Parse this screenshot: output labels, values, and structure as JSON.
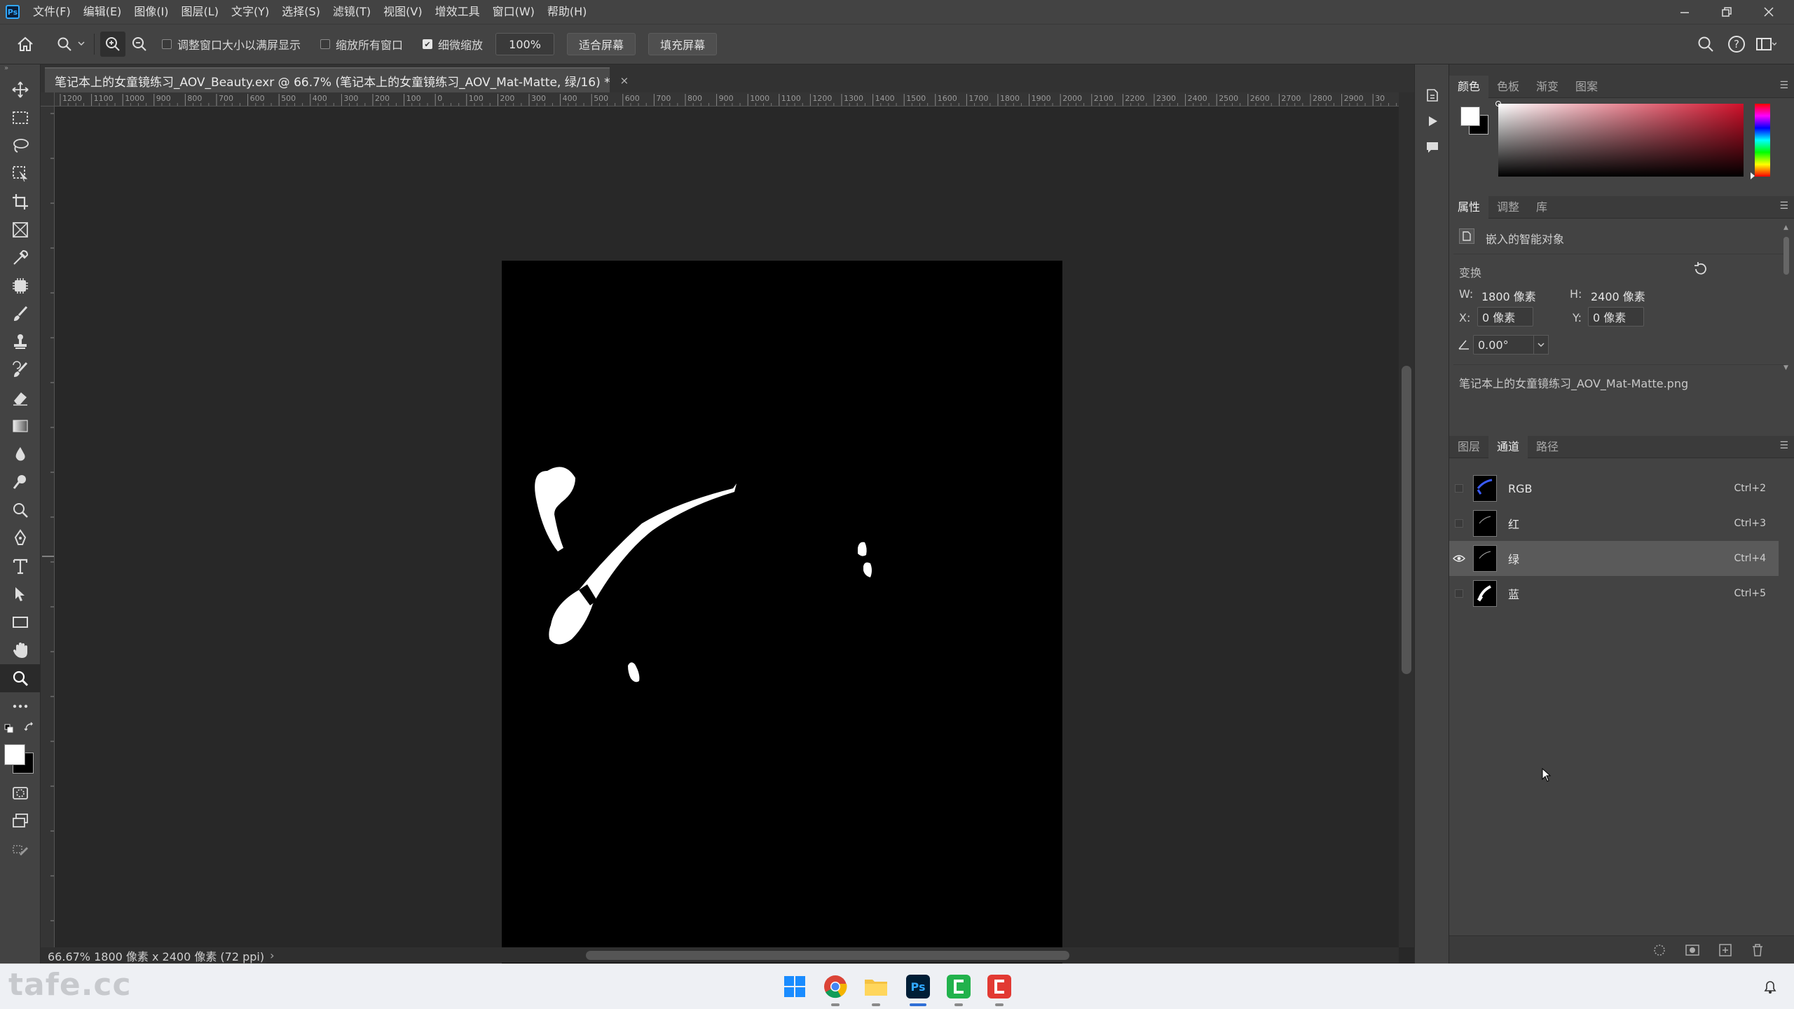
{
  "menubar": {
    "app_logo": "Ps",
    "items": [
      "文件(F)",
      "编辑(E)",
      "图像(I)",
      "图层(L)",
      "文字(Y)",
      "选择(S)",
      "滤镜(T)",
      "视图(V)",
      "增效工具",
      "窗口(W)",
      "帮助(H)"
    ]
  },
  "optionsbar": {
    "resize_windows_label": "调整窗口大小以满屏显示",
    "zoom_all_label": "缩放所有窗口",
    "scrubby_zoom_label": "细微缩放",
    "zoom_value": "100%",
    "fit_screen_label": "适合屏幕",
    "fill_screen_label": "填充屏幕"
  },
  "document": {
    "tab_title": "笔记本上的女童镜练习_AOV_Beauty.exr @ 66.7% (笔记本上的女童镜练习_AOV_Mat-Matte, 绿/16) *",
    "close_glyph": "×",
    "status": "66.67%  1800 像素 x 2400 像素 (72 ppi)",
    "status_arrow": "›"
  },
  "ruler": {
    "h_labels": [
      "1200",
      "1100",
      "1000",
      "900",
      "800",
      "700",
      "600",
      "500",
      "400",
      "300",
      "200",
      "100",
      "0",
      "100",
      "200",
      "300",
      "400",
      "500",
      "600",
      "700",
      "800",
      "900",
      "1000",
      "1100",
      "1200",
      "1300",
      "1400",
      "1500",
      "1600",
      "1700",
      "1800",
      "1900",
      "2000",
      "2100",
      "2200",
      "2300",
      "2400",
      "2500",
      "2600",
      "2700",
      "2800",
      "2900",
      "30"
    ]
  },
  "color_panel": {
    "tabs": [
      "颜色",
      "色板",
      "渐变",
      "图案"
    ],
    "foreground": "#ffffff",
    "background": "#000000",
    "hue_color": "#d0102a"
  },
  "properties_panel": {
    "tabs": [
      "属性",
      "调整",
      "库"
    ],
    "object_type": "嵌入的智能对象",
    "section_transform": "变换",
    "w_label": "W:",
    "w_value": "1800 像素",
    "h_label": "H:",
    "h_value": "2400 像素",
    "x_label": "X:",
    "x_value": "0 像素",
    "y_label": "Y:",
    "y_value": "0 像素",
    "angle_value": "0.00°",
    "filename": "笔记本上的女童镜练习_AOV_Mat-Matte.png"
  },
  "channels_panel": {
    "tabs": [
      "图层",
      "通道",
      "路径"
    ],
    "channels": [
      {
        "name": "RGB",
        "shortcut": "Ctrl+2",
        "visible": false,
        "selected": false
      },
      {
        "name": "红",
        "shortcut": "Ctrl+3",
        "visible": false,
        "selected": false
      },
      {
        "name": "绿",
        "shortcut": "Ctrl+4",
        "visible": true,
        "selected": true
      },
      {
        "name": "蓝",
        "shortcut": "Ctrl+5",
        "visible": false,
        "selected": false
      }
    ]
  },
  "taskbar": {
    "apps": [
      "windows-start",
      "chrome",
      "file-explorer",
      "photoshop",
      "green-app",
      "red-app"
    ],
    "watermark": "tafe.cc"
  }
}
